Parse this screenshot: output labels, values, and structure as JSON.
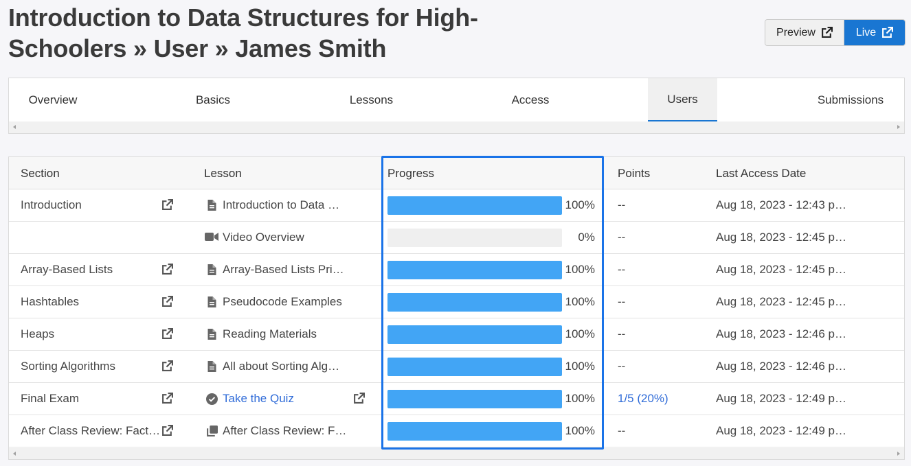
{
  "header": {
    "title": "Introduction to Data Structures for High-Schoolers » User » James Smith",
    "preview_label": "Preview",
    "live_label": "Live"
  },
  "tabs": [
    {
      "label": "Overview",
      "active": false
    },
    {
      "label": "Basics",
      "active": false
    },
    {
      "label": "Lessons",
      "active": false
    },
    {
      "label": "Access",
      "active": false
    },
    {
      "label": "Users",
      "active": true
    },
    {
      "label": "Submissions",
      "active": false
    }
  ],
  "table": {
    "columns": {
      "section": "Section",
      "lesson": "Lesson",
      "progress": "Progress",
      "points": "Points",
      "last_access": "Last Access Date"
    },
    "rows": [
      {
        "section": "Introduction",
        "section_link": true,
        "lesson_icon": "document-icon",
        "lesson": "Introduction to Data …",
        "lesson_link": false,
        "progress": 1.0,
        "progress_label": "100%",
        "points": "--",
        "last_access": "Aug 18, 2023 - 12:43 p…"
      },
      {
        "section": "",
        "section_link": false,
        "lesson_icon": "video-icon",
        "lesson": "Video Overview",
        "lesson_link": false,
        "progress": 0.0,
        "progress_label": "0%",
        "points": "--",
        "last_access": "Aug 18, 2023 - 12:45 p…"
      },
      {
        "section": "Array-Based Lists",
        "section_link": true,
        "lesson_icon": "document-icon",
        "lesson": "Array-Based Lists Pri…",
        "lesson_link": false,
        "progress": 1.0,
        "progress_label": "100%",
        "points": "--",
        "last_access": "Aug 18, 2023 - 12:45 p…"
      },
      {
        "section": "Hashtables",
        "section_link": true,
        "lesson_icon": "document-icon",
        "lesson": "Pseudocode Examples",
        "lesson_link": false,
        "progress": 1.0,
        "progress_label": "100%",
        "points": "--",
        "last_access": "Aug 18, 2023 - 12:45 p…"
      },
      {
        "section": "Heaps",
        "section_link": true,
        "lesson_icon": "document-icon",
        "lesson": "Reading Materials",
        "lesson_link": false,
        "progress": 1.0,
        "progress_label": "100%",
        "points": "--",
        "last_access": "Aug 18, 2023 - 12:46 p…"
      },
      {
        "section": "Sorting Algorithms",
        "section_link": true,
        "lesson_icon": "document-icon",
        "lesson": "All about Sorting Alg…",
        "lesson_link": false,
        "progress": 1.0,
        "progress_label": "100%",
        "points": "--",
        "last_access": "Aug 18, 2023 - 12:46 p…"
      },
      {
        "section": "Final Exam",
        "section_link": true,
        "lesson_icon": "check-circle-icon",
        "lesson": "Take the Quiz",
        "lesson_link": true,
        "progress": 1.0,
        "progress_label": "100%",
        "points": "1/5 (20%)",
        "points_link": true,
        "last_access": "Aug 18, 2023 - 12:49 p…"
      },
      {
        "section": "After Class Review: Fact…",
        "section_link": true,
        "lesson_icon": "copy-icon",
        "lesson": "After Class Review: F…",
        "lesson_link": false,
        "progress": 1.0,
        "progress_label": "100%",
        "points": "--",
        "last_access": "Aug 18, 2023 - 12:49 p…"
      }
    ]
  },
  "colors": {
    "accent": "#1976d2",
    "progress_fill": "#42a5f5",
    "link": "#2f6bd8",
    "highlight": "#1a73e8"
  }
}
